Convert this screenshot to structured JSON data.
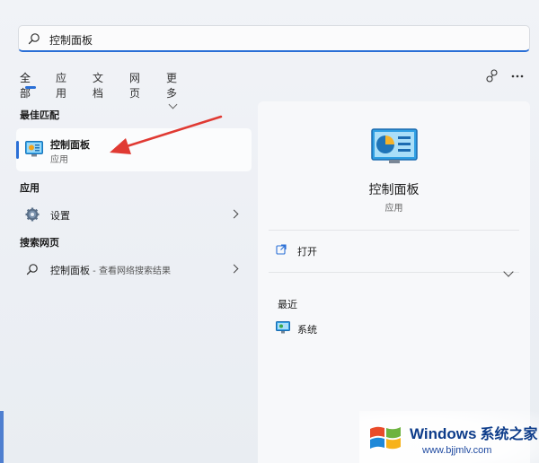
{
  "search": {
    "value": "控制面板",
    "placeholder": ""
  },
  "tabs": [
    {
      "label": "全部",
      "active": true
    },
    {
      "label": "应用"
    },
    {
      "label": "文档"
    },
    {
      "label": "网页"
    },
    {
      "label": "更多"
    }
  ],
  "best_match": {
    "section_label": "最佳匹配",
    "name": "控制面板",
    "type": "应用",
    "icon": "control-panel-icon"
  },
  "apps": {
    "section_label": "应用",
    "items": [
      {
        "label": "设置",
        "icon": "gear-icon"
      }
    ]
  },
  "web": {
    "section_label": "搜索网页",
    "items": [
      {
        "label": "控制面板",
        "suffix": " - 查看网络搜索结果",
        "icon": "search-icon"
      }
    ]
  },
  "detail": {
    "title": "控制面板",
    "subtitle": "应用",
    "actions": [
      {
        "label": "打开",
        "icon": "open-external-icon"
      }
    ],
    "recent_label": "最近",
    "recent": [
      {
        "label": "系统",
        "icon": "system-monitor-icon"
      }
    ]
  },
  "watermark": {
    "brand": "Windows",
    "brand_cn": "系统之家",
    "url": "www.bjjmlv.com"
  },
  "colors": {
    "accent": "#2a6fd6",
    "annotation_arrow": "#e03a33"
  }
}
